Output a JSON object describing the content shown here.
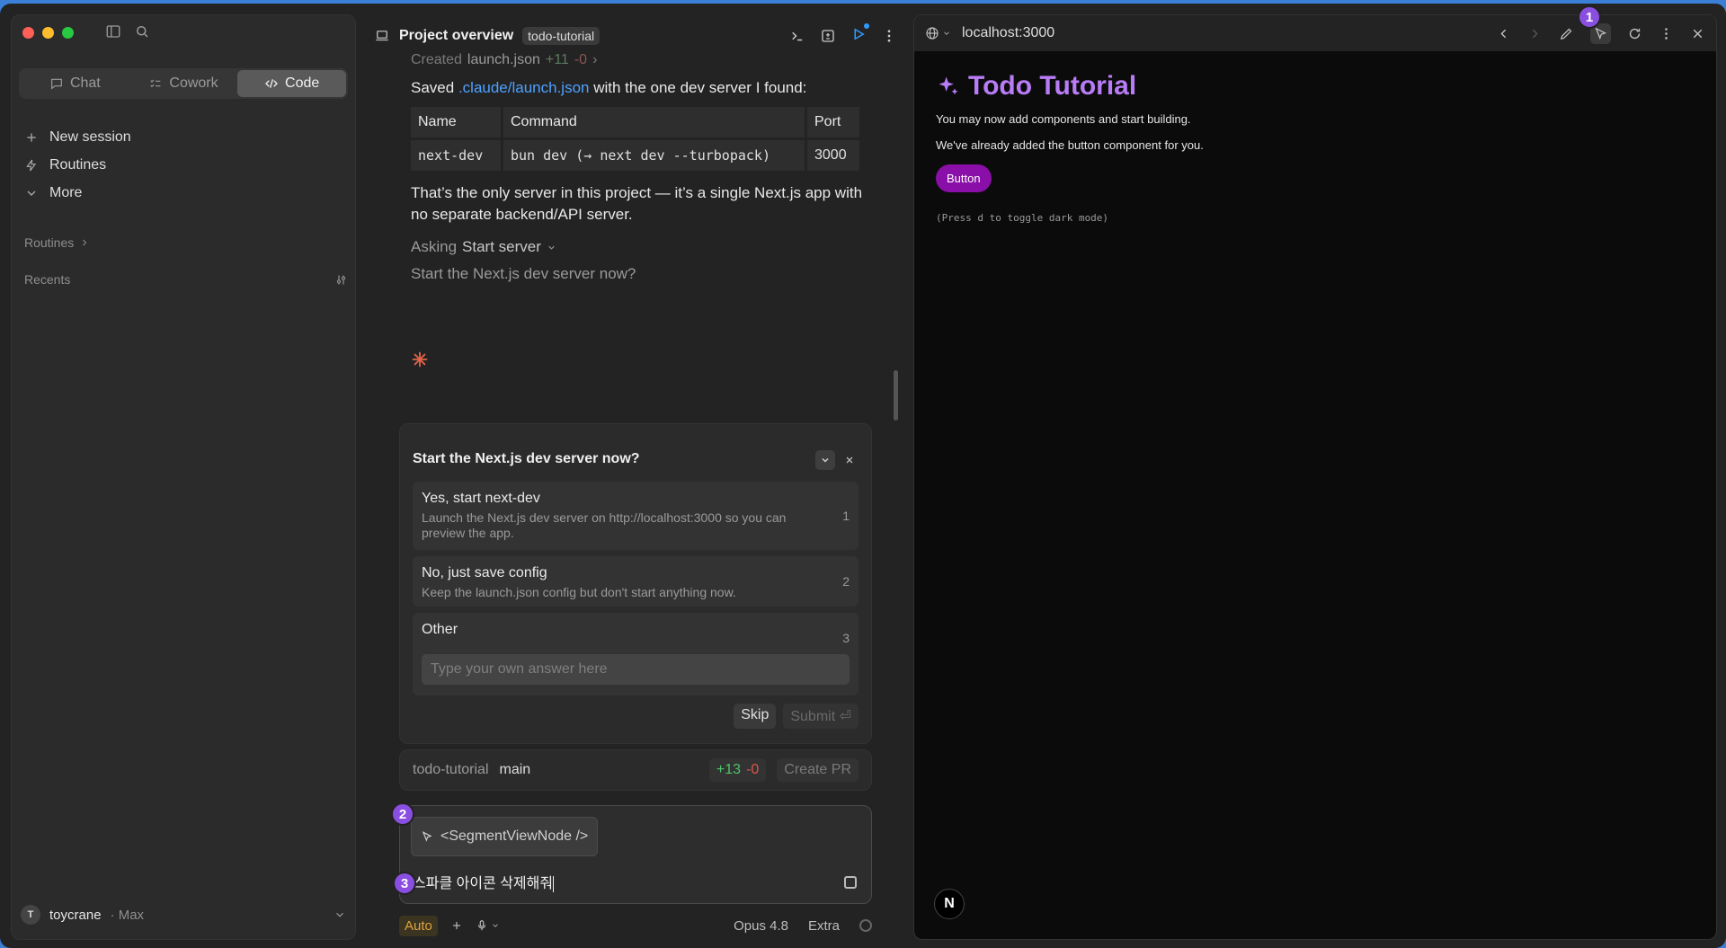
{
  "sidebar": {
    "tabs": [
      {
        "label": "Chat"
      },
      {
        "label": "Cowork"
      },
      {
        "label": "Code"
      }
    ],
    "nav": [
      {
        "label": "New session"
      },
      {
        "label": "Routines"
      },
      {
        "label": "More"
      }
    ],
    "routines_label": "Routines",
    "recents_label": "Recents",
    "user": {
      "initial": "T",
      "name": "toycrane",
      "plan": "· Max"
    }
  },
  "center": {
    "title": "Project overview",
    "badge": "todo-tutorial",
    "created_line": {
      "prefix": "Created",
      "file": "launch.json",
      "added": "+11",
      "removed": "-0"
    },
    "saved_msg": {
      "before": "Saved ",
      "link": ".claude/launch.json",
      "after": " with the one dev server I found:"
    },
    "table": {
      "headers": [
        "Name",
        "Command",
        "Port"
      ],
      "rows": [
        [
          "next-dev",
          "bun dev (→ next dev --turbopack)",
          "3000"
        ]
      ]
    },
    "only_server_msg": "That’s the only server in this project — it’s a single Next.js app with no separate backend/API server.",
    "asking": {
      "prefix": "Asking",
      "topic": "Start server"
    },
    "question_preview": "Start the Next.js dev server now?"
  },
  "question_card": {
    "title": "Start the Next.js dev server now?",
    "options": [
      {
        "label": "Yes, start next-dev",
        "desc": "Launch the Next.js dev server on http://localhost:3000 so you can preview the app.",
        "num": "1"
      },
      {
        "label": "No, just save config",
        "desc": "Keep the launch.json config but don't start anything now.",
        "num": "2"
      },
      {
        "label": "Other",
        "num": "3",
        "placeholder": "Type your own answer here"
      }
    ],
    "skip": "Skip",
    "submit": "Submit ⏎"
  },
  "branch": {
    "repo": "todo-tutorial",
    "branch": "main",
    "added": "+13",
    "removed": "-0",
    "create_pr": "Create PR"
  },
  "composer": {
    "chip": "<SegmentViewNode />",
    "prompt": "스파클 아이콘 삭제해줘",
    "markers": [
      "1",
      "2",
      "3"
    ]
  },
  "bottom": {
    "mode": "Auto",
    "model": "Opus 4.8",
    "effort": "Extra"
  },
  "preview": {
    "url": "localhost:3000",
    "heading": "Todo Tutorial",
    "line1": "You may now add components and start building.",
    "line2": "We've already added the button component for you.",
    "button": "Button",
    "hint": "(Press d to toggle dark mode)",
    "next_badge": "N"
  },
  "colors": {
    "accent_purple": "#8a4fe0",
    "heading_purple": "#b97cf7",
    "button_purple": "#8a0fa8",
    "link_blue": "#4ea1ff",
    "diff_green": "#4cc36a",
    "diff_red": "#e0544c",
    "auto_orange": "#e0a340"
  }
}
